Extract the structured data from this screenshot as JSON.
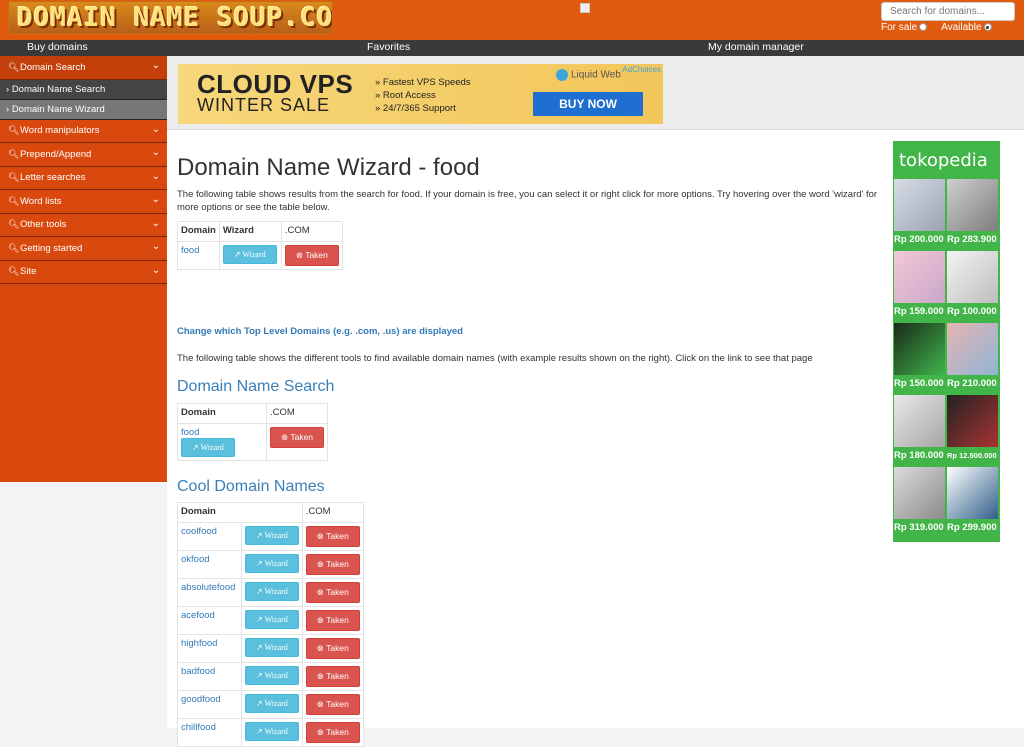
{
  "header": {
    "logo_text": "DOMAIN NAME SOUP.COM",
    "search_placeholder": "Search for domains...",
    "radio_for_sale": "For sale",
    "radio_available": "Available"
  },
  "nav": {
    "buy": "Buy domains",
    "favorites": "Favorites",
    "manager": "My domain manager"
  },
  "sidebar": {
    "domain_search": "Domain Search",
    "sub1": "Domain Name Search",
    "sub2": "Domain Name Wizard",
    "word_manipulators": "Word manipulators",
    "prepend": "Prepend/Append",
    "letter": "Letter searches",
    "word_lists": "Word lists",
    "other": "Other tools",
    "getting_started": "Getting started",
    "site": "Site"
  },
  "banner": {
    "line1": "CLOUD VPS",
    "line2": "WINTER SALE",
    "b1": "» Fastest VPS Speeds",
    "b2": "» Root Access",
    "b3": "» 24/7/365 Support",
    "brand": "Liquid Web",
    "adchoices": "AdChoices",
    "buy": "BUY NOW"
  },
  "page": {
    "title": "Domain Name Wizard - food",
    "intro": "The following table shows results from the search for food. If your domain is free, you can select it or right click for more options. Try hovering over the word 'wizard' for more options or see the table below.",
    "tld_link": "Change which Top Level Domains (e.g. .com, .us) are displayed",
    "tools_text": "The following table shows the different tools to find available domain names (with example results shown on the right). Click on the link to see that page"
  },
  "labels": {
    "domain": "Domain",
    "wizard": "Wizard",
    "com": ".COM",
    "wizard_btn": "Wizard",
    "taken_btn": "Taken"
  },
  "table1": {
    "rows": [
      "food"
    ]
  },
  "section2": {
    "title": "Domain Name Search",
    "rows": [
      "food"
    ]
  },
  "section3": {
    "title": "Cool Domain Names",
    "rows": [
      "coolfood",
      "okfood",
      "absolutefood",
      "acefood",
      "highfood",
      "badfood",
      "goodfood",
      "chillfood"
    ]
  },
  "sidead": {
    "brand": "tokopedia",
    "prices": [
      "Rp 200.000",
      "Rp 283.900",
      "Rp 159.000",
      "Rp 100.000",
      "Rp 150.000",
      "Rp 210.000",
      "Rp 180.000",
      "Rp 12.500.000",
      "Rp 319.000",
      "Rp 299.900"
    ]
  },
  "colors": {
    "brand_orange": "#e15b0f",
    "link_blue": "#337ab7",
    "wizard_btn": "#5bc0de",
    "taken_btn": "#d9534f",
    "ad_green": "#42b549"
  }
}
